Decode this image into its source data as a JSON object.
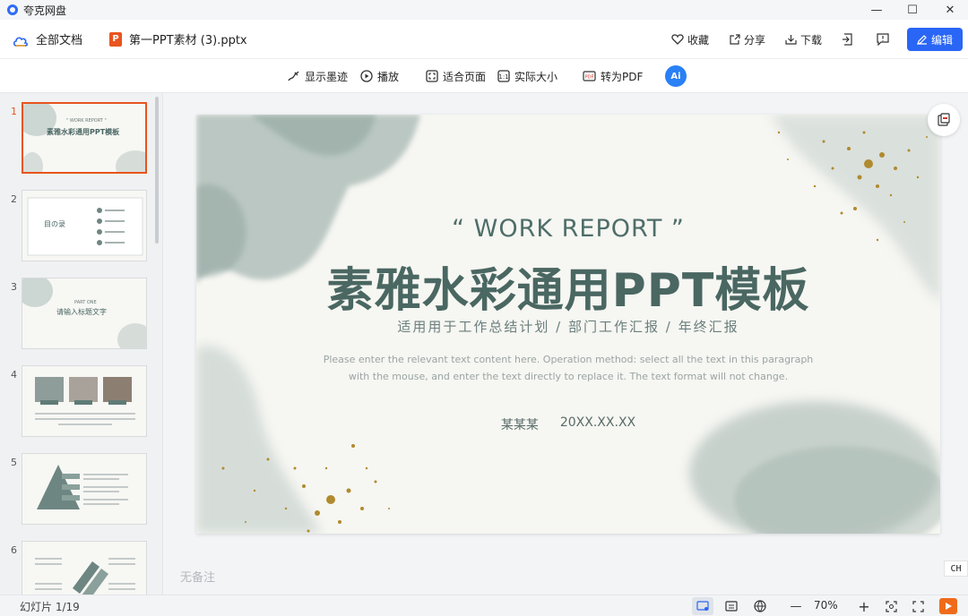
{
  "app": {
    "title": "夸克网盘"
  },
  "window_controls": {
    "minimize": "—",
    "maximize": "☐",
    "close": "✕"
  },
  "header": {
    "all_docs": "全部文档",
    "file_name": "第一PPT素材 (3).pptx",
    "file_type_badge": "P",
    "favorite": "收藏",
    "share": "分享",
    "download": "下载",
    "edit": "编辑"
  },
  "toolbar": {
    "show_ink": "显示墨迹",
    "play": "播放",
    "fit_page": "适合页面",
    "actual_size": "实际大小",
    "to_pdf": "转为PDF",
    "ai": "Ai"
  },
  "thumbnails": [
    {
      "num": "1",
      "active": true,
      "line1": "\" WORK REPORT \"",
      "line2": "素雅水彩通用PPT模板"
    },
    {
      "num": "2",
      "active": false,
      "line1": "目の录",
      "line2": ""
    },
    {
      "num": "3",
      "active": false,
      "line1": "PART ONE",
      "line2": "请输入标题文字"
    },
    {
      "num": "4",
      "active": false,
      "line1": "",
      "line2": ""
    },
    {
      "num": "5",
      "active": false,
      "line1": "",
      "line2": ""
    },
    {
      "num": "6",
      "active": false,
      "line1": "",
      "line2": ""
    }
  ],
  "slide": {
    "quote": "“ WORK REPORT ”",
    "title": "素雅水彩通用PPT模板",
    "subtitle": "适用用于工作总结计划 / 部门工作汇报 / 年终汇报",
    "description": "Please enter the relevant text content here. Operation method: select all the text in this paragraph with the mouse, and enter the text directly to replace it. The text format will not change.",
    "author": "某某某",
    "date": "20XX.XX.XX"
  },
  "notes": {
    "placeholder": "无备注"
  },
  "ime_badge": "CH",
  "status": {
    "slide_count": "幻灯片 1/19",
    "zoom": "70%",
    "zoom_out": "—",
    "zoom_in": "+"
  },
  "colors": {
    "accent": "#2a66f5",
    "ppt_orange": "#e8541e",
    "slide_text": "#4a6762",
    "watercolor": "#a9bab5",
    "gold": "#b08a2e"
  }
}
